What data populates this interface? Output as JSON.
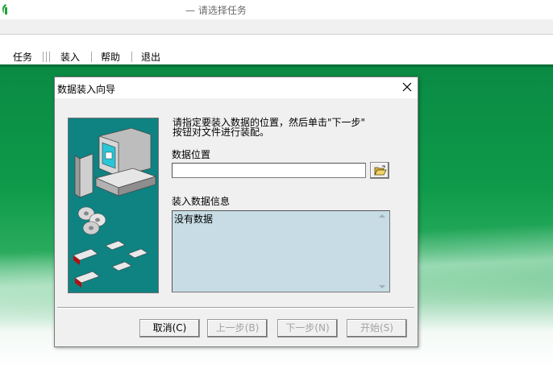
{
  "app": {
    "title": "— 请选择任务",
    "icon": "green-leaf-icon"
  },
  "menu": {
    "items": [
      "任务",
      "装入",
      "帮助",
      "退出"
    ]
  },
  "dialog": {
    "title": "数据装入向导",
    "close_icon": "close-icon",
    "illustration": "computer-disks-tapes-illustration",
    "instruction": "请指定要装入数据的位置，然后单击\"下一步\"\n按钮对文件进行装配。",
    "location_label": "数据位置",
    "location_value": "",
    "browse_icon": "open-folder-icon",
    "info_label": "装入数据信息",
    "info_text": "没有数据",
    "buttons": {
      "cancel": "取消(C)",
      "prev": "上一步(B)",
      "next": "下一步(N)",
      "start": "开始(S)"
    }
  },
  "colors": {
    "desktop_green": "#0e9a4a",
    "illustration_teal": "#0f8282",
    "info_box_bg": "#c7dce4",
    "dialog_bg": "#f0f0f0"
  }
}
